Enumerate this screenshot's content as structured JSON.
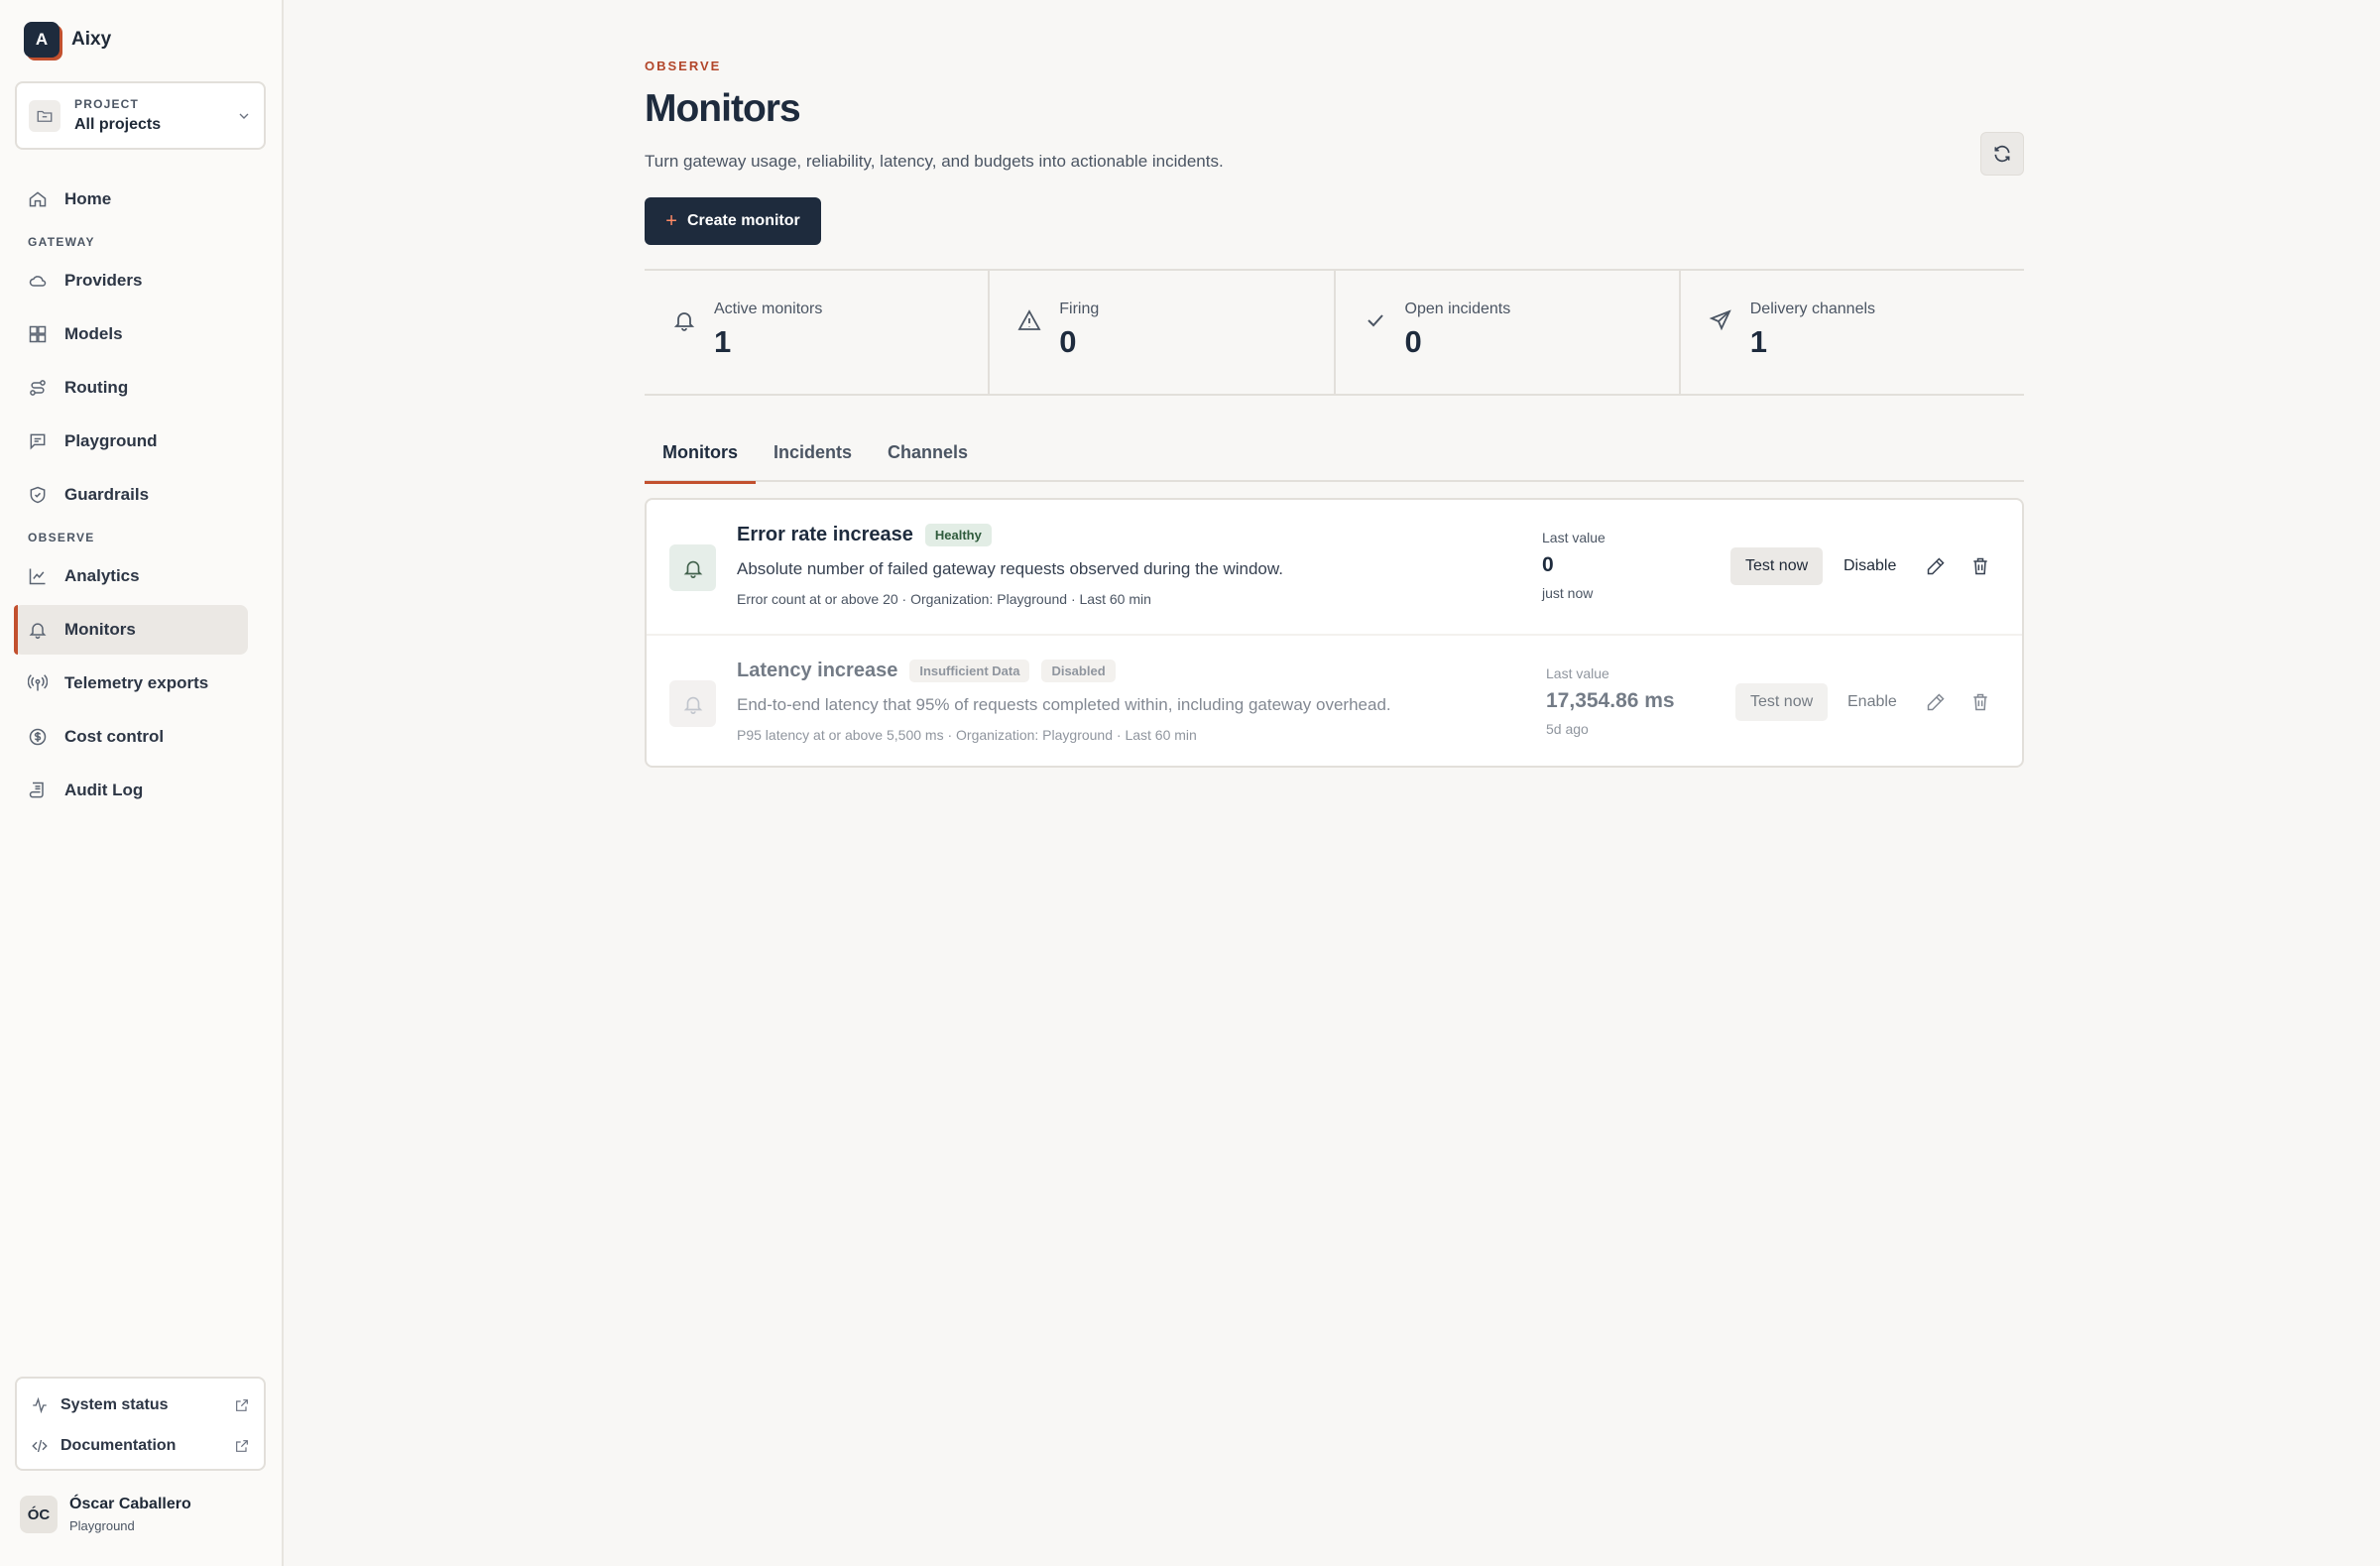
{
  "app": {
    "logo_letter": "A",
    "name": "Aixy"
  },
  "project": {
    "label": "PROJECT",
    "value": "All projects"
  },
  "nav": {
    "home": "Home",
    "section_gateway": "GATEWAY",
    "providers": "Providers",
    "models": "Models",
    "routing": "Routing",
    "playground": "Playground",
    "guardrails": "Guardrails",
    "section_observe": "OBSERVE",
    "analytics": "Analytics",
    "monitors": "Monitors",
    "telemetry": "Telemetry exports",
    "cost": "Cost control",
    "audit": "Audit Log"
  },
  "footer_links": {
    "status": "System status",
    "docs": "Documentation"
  },
  "user": {
    "initials": "ÓC",
    "name": "Óscar Caballero",
    "org": "Playground"
  },
  "page": {
    "eyebrow": "OBSERVE",
    "title": "Monitors",
    "description": "Turn gateway usage, reliability, latency, and budgets into actionable incidents.",
    "create_label": "Create monitor"
  },
  "stats": [
    {
      "label": "Active monitors",
      "value": "1",
      "icon": "bell-icon"
    },
    {
      "label": "Firing",
      "value": "0",
      "icon": "alert-triangle-icon"
    },
    {
      "label": "Open incidents",
      "value": "0",
      "icon": "check-icon"
    },
    {
      "label": "Delivery channels",
      "value": "1",
      "icon": "send-icon"
    }
  ],
  "tabs": [
    "Monitors",
    "Incidents",
    "Channels"
  ],
  "monitors": [
    {
      "name": "Error rate increase",
      "badges": [
        "Healthy"
      ],
      "description": "Absolute number of failed gateway requests observed during the window.",
      "meta": "Error count at or above 20 · Organization: Playground · Last 60 min",
      "last_value_label": "Last value",
      "last_value": "0",
      "last_when": "just now",
      "test_label": "Test now",
      "toggle_label": "Disable"
    },
    {
      "name": "Latency increase",
      "badges": [
        "Insufficient Data",
        "Disabled"
      ],
      "description": "End-to-end latency that 95% of requests completed within, including gateway overhead.",
      "meta": "P95 latency at or above 5,500 ms · Organization: Playground · Last 60 min",
      "last_value_label": "Last value",
      "last_value": "17,354.86 ms",
      "last_when": "5d ago",
      "test_label": "Test now",
      "toggle_label": "Enable"
    }
  ],
  "colors": {
    "accent": "#c2502e",
    "navy": "#1e2b3d",
    "healthy_bg": "#e2ede5"
  }
}
